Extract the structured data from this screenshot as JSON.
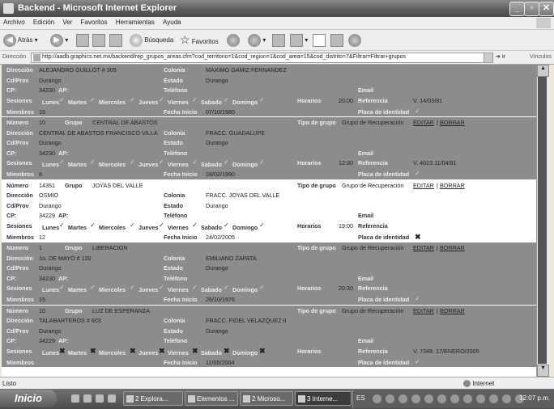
{
  "window": {
    "title": "Backend - Microsoft Internet Explorer"
  },
  "menu": [
    "Archivo",
    "Edición",
    "Ver",
    "Favoritos",
    "Herramientas",
    "Ayuda"
  ],
  "toolbar": {
    "back": "Atrás",
    "search": "Búsqueda",
    "favorites": "Favoritos"
  },
  "address": {
    "label": "Dirección",
    "url": "http://aadb.graphics.net.mx/backend/rep_grupos_areas.cfm?cod_territorio=1&cod_region=1&cod_area=15&cod_distrito=7&Filtrar=Filtrar+grupos",
    "go": "Ir",
    "links": "Vínculos"
  },
  "labels": {
    "numero": "Número",
    "grupo": "Grupo",
    "tipo": "Tipo de grupo",
    "direccion": "Dirección",
    "colonia": "Colonia",
    "cdprov": "Cd/Prov",
    "estado": "Estado",
    "cp": "CP:",
    "ap": "AP:",
    "telefono": "Teléfono",
    "email": "Email",
    "sesiones": "Sesiones",
    "horarios": "Horarios",
    "referencia": "Referencia",
    "miembros": "Miembros",
    "fecha": "Fecha Inicio",
    "placa": "Placa de identidad",
    "editar": "EDITAR",
    "borrar": "BORRAR",
    "days": [
      "Lunes",
      "Martes",
      "Miercoles",
      "Jueves",
      "Viernes",
      "Sabado",
      "Domingo"
    ]
  },
  "records": [
    {
      "style": "dark",
      "partial": true,
      "direccion": "ALEJANDRO GUILLOT # 305",
      "colonia": "MAXIMO GAMIZ FERNANDEZ",
      "cdprov": "Durango",
      "estado": "Durango",
      "cp": "34230",
      "horario": "20:00",
      "referencia": "V. 14/03/81",
      "miembros": "16",
      "fecha": "07/10/1980",
      "sessions": [
        "check",
        "check",
        "check",
        "check",
        "check",
        "check",
        "check"
      ],
      "placa": "check"
    },
    {
      "style": "dark",
      "numero": "10",
      "grupo": "CENTRAL DE ABASTOS",
      "tipo": "Grupo de Recuperación",
      "direccion": "CENTRAL DE ABASTOS FRANCISCO VILLA",
      "colonia": "FRACC. GUADALUPE",
      "cdprov": "Durango",
      "estado": "Durango",
      "cp": "34230",
      "horario": "12:30",
      "referencia": "V. 4023 11/04/91",
      "miembros": "8",
      "fecha": "28/02/1990",
      "sessions": [
        "check",
        "check",
        "check",
        "check",
        "check",
        "check",
        "check"
      ],
      "placa": "check"
    },
    {
      "style": "light",
      "numero": "14351",
      "grupo": "JOYAS DEL VALLE",
      "tipo": "Grupo de Recuperación",
      "direccion": "OSMIO",
      "colonia": "FRACC. JOYAS DEL VALLE",
      "cdprov": "Durango",
      "estado": "Durango",
      "cp": "34229",
      "horario": "19:00",
      "referencia": "",
      "miembros": "12",
      "fecha": "24/02/2005",
      "sessions": [
        "check",
        "check",
        "check",
        "check",
        "check",
        "check",
        "check"
      ],
      "placa": "cross"
    },
    {
      "style": "dark",
      "numero": "1",
      "grupo": "LIBERACION",
      "tipo": "Grupo de Recuperación",
      "direccion": "1o. DE MAYO # 120",
      "colonia": "EMILIANO ZAPATA",
      "cdprov": "Durango",
      "estado": "Durango",
      "cp": "34230",
      "horario": "20:30",
      "referencia": "",
      "miembros": "15",
      "fecha": "26/10/1976",
      "sessions": [
        "check",
        "check",
        "check",
        "check",
        "check",
        "check",
        "check"
      ],
      "placa": "check"
    },
    {
      "style": "dark",
      "numero": "10",
      "grupo": "LUZ DE ESPERANZA",
      "tipo": "Grupo de Recuperación",
      "direccion": "TALABARTEROS # 603",
      "colonia": "FRACC. FIDEL VELAZQUEZ II",
      "cdprov": "Durango",
      "estado": "Durango",
      "cp": "34229",
      "horario": "",
      "referencia": "V. 7348. 17/ENERO/2005",
      "miembros": "",
      "fecha": "11/05/2004",
      "sessions": [
        "cross",
        "cross",
        "cross",
        "cross",
        "cross",
        "cross",
        "cross"
      ],
      "placa": "check"
    }
  ],
  "status": {
    "left": "Listo",
    "zone": "Internet"
  },
  "taskbar": {
    "start": "Inicio",
    "tasks": [
      "2 Explora...",
      "Elementos ...",
      "2 Microso...",
      "3 Interne..."
    ],
    "lang": "ES",
    "clock": "12:07 p.m."
  }
}
